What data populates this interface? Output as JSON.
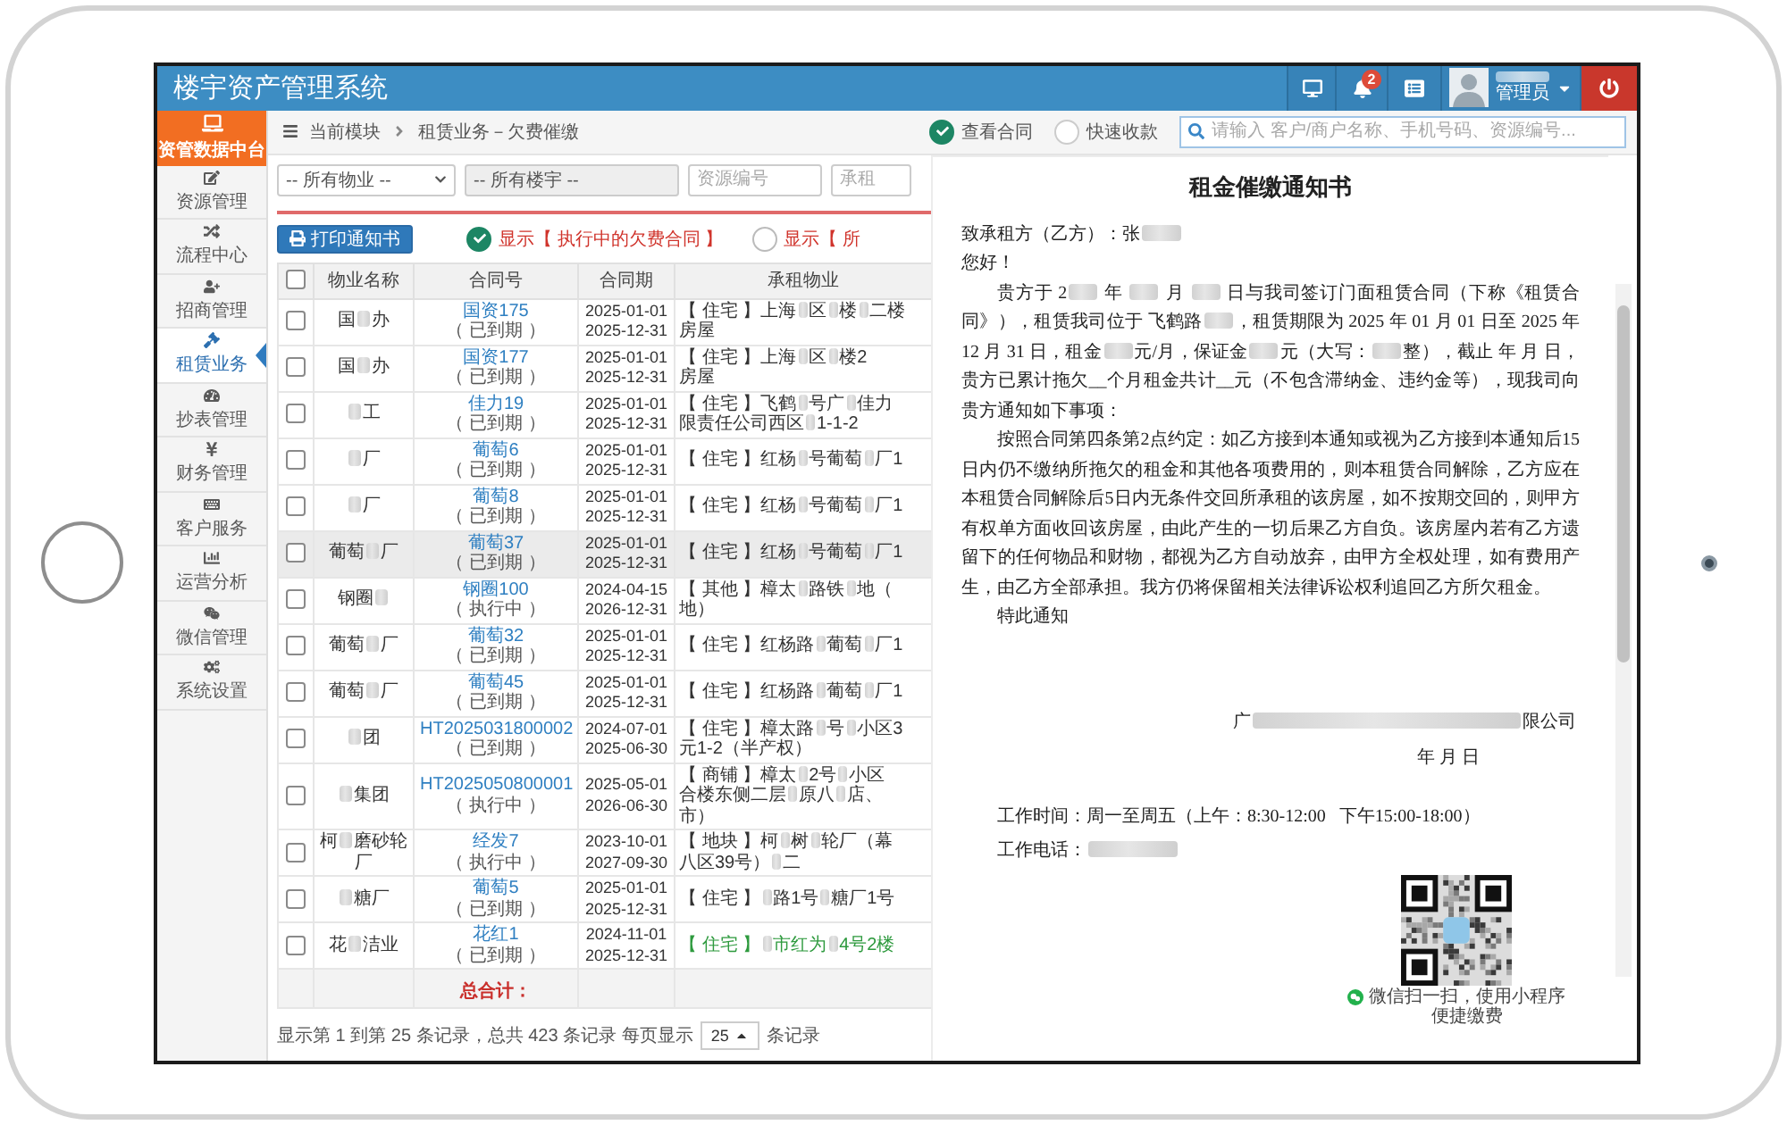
{
  "header": {
    "title": "楼宇资产管理系统",
    "notifications": "2",
    "user_role": "管理员"
  },
  "sidebar": {
    "home": "资管数据中台",
    "items": [
      {
        "label": "资源管理",
        "selected": false
      },
      {
        "label": "流程中心",
        "selected": false
      },
      {
        "label": "招商管理",
        "selected": false
      },
      {
        "label": "租赁业务",
        "selected": true
      },
      {
        "label": "抄表管理",
        "selected": false
      },
      {
        "label": "财务管理",
        "selected": false
      },
      {
        "label": "客户服务",
        "selected": false
      },
      {
        "label": "运营分析",
        "selected": false
      },
      {
        "label": "微信管理",
        "selected": false
      },
      {
        "label": "系统设置",
        "selected": false
      }
    ]
  },
  "breadcrumb": {
    "module": "当前模块",
    "page": "租赁业务－欠费催缴"
  },
  "actions": [
    {
      "label": "查看合同",
      "selected": true
    },
    {
      "label": "快速收款",
      "selected": false
    }
  ],
  "search": {
    "placeholder": "请输入 客户/商户名称、手机号码、资源编号..."
  },
  "filters": [
    {
      "kind": "select",
      "value": "-- 所有物业 --",
      "disabled": false
    },
    {
      "kind": "select",
      "value": "-- 所有楼宇 --",
      "disabled": true
    },
    {
      "kind": "input",
      "placeholder": "资源编号",
      "disabled": false
    },
    {
      "kind": "input",
      "placeholder": "承租",
      "disabled": false
    }
  ],
  "print_button": "打印通知书",
  "filter_options": [
    {
      "label": "显示【 执行中的欠费合同 】",
      "selected": true
    },
    {
      "label": "显示【 所",
      "selected": false
    }
  ],
  "table": {
    "columns": [
      "物业名称",
      "合同号",
      "合同期",
      "承租物业"
    ],
    "header_checked": false,
    "rows": [
      {
        "checked": false,
        "highlighted": false,
        "color": "#333333",
        "name": [
          "国",
          {
            "redacted": true
          },
          "办"
        ],
        "contract": "国资175",
        "status": "（ 已到期 ）",
        "start": "2025-01-01",
        "end": "2025-12-31",
        "property": [
          [
            "【 住宅 】上海",
            {
              "redacted": true
            },
            "区",
            {
              "redacted": true
            },
            "楼",
            {
              "redacted": true
            },
            "二楼"
          ],
          [
            "房屋"
          ]
        ]
      },
      {
        "checked": false,
        "highlighted": false,
        "color": "#333333",
        "name": [
          "国",
          {
            "redacted": true
          },
          "办"
        ],
        "contract": "国资177",
        "status": "（ 已到期 ）",
        "start": "2025-01-01",
        "end": "2025-12-31",
        "property": [
          [
            "【 住宅 】上海",
            {
              "redacted": true
            },
            "区",
            {
              "redacted": true
            },
            "楼2"
          ],
          [
            "房屋"
          ]
        ]
      },
      {
        "checked": false,
        "highlighted": false,
        "color": "#333333",
        "name": [
          {
            "redacted": true
          },
          "工"
        ],
        "contract": "佳力19",
        "status": "（ 已到期 ）",
        "start": "2025-01-01",
        "end": "2025-12-31",
        "property": [
          [
            "【 住宅 】飞鹤",
            {
              "redacted": true
            },
            "号广",
            {
              "redacted": true
            },
            "佳力"
          ],
          [
            "限责任公司西区",
            {
              "redacted": true
            },
            "1-1-2"
          ]
        ]
      },
      {
        "checked": false,
        "highlighted": false,
        "color": "#333333",
        "name": [
          {
            "redacted": true
          },
          "厂"
        ],
        "contract": "葡萄6",
        "status": "（ 已到期 ）",
        "start": "2025-01-01",
        "end": "2025-12-31",
        "property": [
          [
            "【 住宅 】红杨",
            {
              "redacted": true
            },
            "号葡萄",
            {
              "redacted": true
            },
            "厂1"
          ]
        ]
      },
      {
        "checked": false,
        "highlighted": false,
        "color": "#333333",
        "name": [
          {
            "redacted": true
          },
          "厂"
        ],
        "contract": "葡萄8",
        "status": "（ 已到期 ）",
        "start": "2025-01-01",
        "end": "2025-12-31",
        "property": [
          [
            "【 住宅 】红杨",
            {
              "redacted": true
            },
            "号葡萄",
            {
              "redacted": true
            },
            "厂1"
          ]
        ]
      },
      {
        "checked": false,
        "highlighted": true,
        "color": "#333333",
        "name": [
          "葡萄",
          {
            "redacted": true
          },
          "厂"
        ],
        "contract": "葡萄37",
        "status": "（ 已到期 ）",
        "start": "2025-01-01",
        "end": "2025-12-31",
        "property": [
          [
            "【 住宅 】红杨",
            {
              "redacted": true
            },
            "号葡萄",
            {
              "redacted": true
            },
            "厂1"
          ]
        ]
      },
      {
        "checked": false,
        "highlighted": false,
        "color": "#333333",
        "name": [
          "钢圈",
          {
            "redacted": true
          }
        ],
        "contract": "钢圈100",
        "status": "（ 执行中 ）",
        "start": "2024-04-15",
        "end": "2026-12-31",
        "property": [
          [
            "【 其他 】樟太",
            {
              "redacted": true
            },
            "路铁",
            {
              "redacted": true
            },
            "地（"
          ],
          [
            "地）"
          ]
        ]
      },
      {
        "checked": false,
        "highlighted": false,
        "color": "#333333",
        "name": [
          "葡萄",
          {
            "redacted": true
          },
          "厂"
        ],
        "contract": "葡萄32",
        "status": "（ 已到期 ）",
        "start": "2025-01-01",
        "end": "2025-12-31",
        "property": [
          [
            "【 住宅 】红杨路",
            {
              "redacted": true
            },
            "葡萄",
            {
              "redacted": true
            },
            "厂1"
          ]
        ]
      },
      {
        "checked": false,
        "highlighted": false,
        "color": "#333333",
        "name": [
          "葡萄",
          {
            "redacted": true
          },
          "厂"
        ],
        "contract": "葡萄45",
        "status": "（ 已到期 ）",
        "start": "2025-01-01",
        "end": "2025-12-31",
        "property": [
          [
            "【 住宅 】红杨路",
            {
              "redacted": true
            },
            "葡萄",
            {
              "redacted": true
            },
            "厂1"
          ]
        ]
      },
      {
        "checked": false,
        "highlighted": false,
        "color": "#333333",
        "name": [
          {
            "redacted": true
          },
          "团"
        ],
        "contract": "HT2025031800002",
        "status": "（ 已到期 ）",
        "start": "2024-07-01",
        "end": "2025-06-30",
        "property": [
          [
            "【 住宅 】樟太路",
            {
              "redacted": true
            },
            "号",
            {
              "redacted": true
            },
            "小区3"
          ],
          [
            "元1-2（半产权）"
          ]
        ]
      },
      {
        "checked": false,
        "highlighted": false,
        "color": "#333333",
        "name": [
          {
            "redacted": true
          },
          "集团"
        ],
        "contract": "HT2025050800001",
        "status": "（ 执行中 ）",
        "start": "2025-05-01",
        "end": "2026-06-30",
        "property": [
          [
            "【 商铺 】樟太",
            {
              "redacted": true
            },
            "2号",
            {
              "redacted": true
            },
            "小区"
          ],
          [
            "合楼东侧二层",
            {
              "redacted": true
            },
            "原八",
            {
              "redacted": true
            },
            "店、"
          ],
          [
            "市）"
          ]
        ]
      },
      {
        "checked": false,
        "highlighted": false,
        "color": "#333333",
        "name": [
          "柯",
          {
            "redacted": true
          },
          "磨砂轮厂"
        ],
        "contract": "经发7",
        "status": "（ 执行中 ）",
        "start": "2023-10-01",
        "end": "2027-09-30",
        "property": [
          [
            "【 地块 】柯",
            {
              "redacted": true
            },
            "树",
            {
              "redacted": true
            },
            "轮厂（幕"
          ],
          [
            "八区39号）",
            {
              "redacted": true
            },
            "二"
          ]
        ]
      },
      {
        "checked": false,
        "highlighted": false,
        "color": "#333333",
        "name": [
          {
            "redacted": true
          },
          "糖厂"
        ],
        "contract": "葡萄5",
        "status": "（ 已到期 ）",
        "start": "2025-01-01",
        "end": "2025-12-31",
        "property": [
          [
            "【 住宅 】",
            {
              "redacted": true
            },
            "路1号",
            {
              "redacted": true
            },
            "糖厂1号"
          ]
        ]
      },
      {
        "checked": false,
        "highlighted": false,
        "color": "#2e9a3e",
        "name": [
          "花",
          {
            "redacted": true
          },
          "洁业"
        ],
        "contract": "花红1",
        "status": "（ 已到期 ）",
        "start": "2024-11-01",
        "end": "2025-12-31",
        "property": [
          [
            "【 住宅 】",
            {
              "redacted": true
            },
            "市红为",
            {
              "redacted": true
            },
            "4号2楼"
          ]
        ]
      }
    ],
    "total_label": "总合计："
  },
  "pagination": {
    "summary": "显示第 1 到第 25 条记录，总共 423 条记录 每页显示",
    "page_size": "25",
    "suffix": "条记录"
  },
  "notice": {
    "title": "租金催缴通知书",
    "addressee": [
      "致承租方（乙方）：张",
      {
        "redacted": true
      }
    ],
    "greeting": "您好！",
    "paragraphs": [
      [
        "贵方于 2",
        {
          "redacted": true
        },
        " 年 ",
        {
          "redacted": true
        },
        " 月 ",
        {
          "redacted": true
        },
        " 日与我司签订门面租赁合同（下称《租赁合同》），租赁我司位于 飞鹤路",
        {
          "redacted": true
        },
        "，租赁期限为 2025 年 01 月 01 日至 2025 年 12 月 31 日，租金",
        {
          "redacted": true
        },
        "元/月，保证金",
        {
          "redacted": true
        },
        "元（大写：",
        {
          "redacted": true
        },
        "整），截止 年 月 日，贵方已累计拖欠__个月租金共计__元（不包含滞纳金、违约金等），现我司向贵方通知如下事项："
      ],
      [
        "按照合同第四条第2点约定：如乙方接到本通知或视为乙方接到本通知后15日内仍不缴纳所拖欠的租金和其他各项费用的，则本租赁合同解除，乙方应在本租赁合同解除后5日内无条件交回所承租的该房屋，如不按期交回的，则甲方有权单方面收回该房屋，由此产生的一切后果乙方自负。该房屋内若有乙方遗留下的任何物品和财物，都视为乙方自动放弃，由甲方全权处理，如有费用产生，由乙方全部承担。我方仍将保留相关法律诉讼权利追回乙方所欠租金。"
      ]
    ],
    "closing": "特此通知",
    "company": [
      "广",
      {
        "redacted": true
      },
      "限公司"
    ],
    "date": "年 月 日",
    "work_hours": "工作时间：周一至周五（上午：8:30-12:00   下午15:00-18:00）",
    "phone": [
      "工作电话：",
      {
        "redacted": true
      }
    ],
    "qr_caption": [
      "微信扫一扫，使用小程序",
      "便捷缴费"
    ]
  }
}
